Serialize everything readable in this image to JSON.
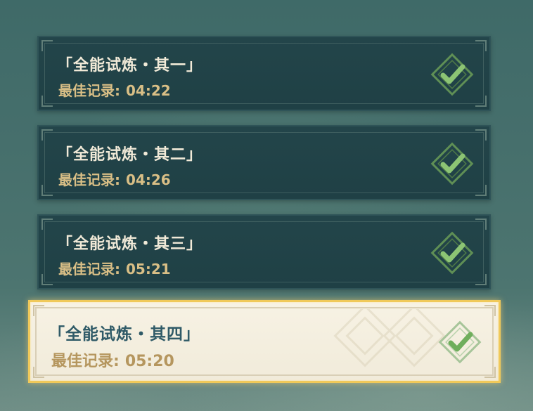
{
  "trials": [
    {
      "title": "「全能试炼・其一」",
      "record_label": "最佳记录:",
      "record_time": "04:22",
      "completed": true,
      "selected": false
    },
    {
      "title": "「全能试炼・其二」",
      "record_label": "最佳记录:",
      "record_time": "04:26",
      "completed": true,
      "selected": false
    },
    {
      "title": "「全能试炼・其三」",
      "record_label": "最佳记录:",
      "record_time": "05:21",
      "completed": true,
      "selected": false
    },
    {
      "title": "「全能试炼・其四」",
      "record_label": "最佳记录:",
      "record_time": "05:20",
      "completed": true,
      "selected": true
    }
  ],
  "colors": {
    "card_bg": "#23454a",
    "title_text": "#f1ead8",
    "record_text": "#d9bf86",
    "selected_bg": "#f7f2e4",
    "selected_border": "#f0c95a",
    "selected_title": "#2f5a67",
    "selected_record": "#b5965e",
    "check_green": "#7fb86a"
  },
  "icons": {
    "completed": "checkmark-diamond-icon"
  }
}
